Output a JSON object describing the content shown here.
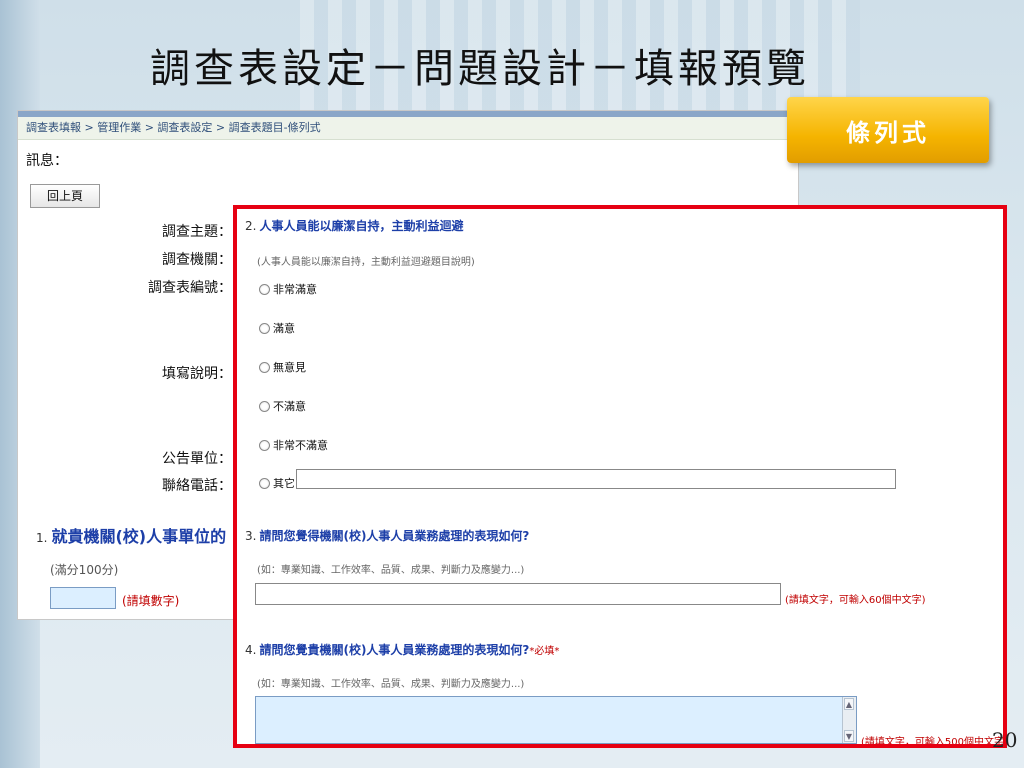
{
  "slide": {
    "title": "調查表設定－問題設計－填報預覽",
    "badge": "條列式",
    "page_number": "20"
  },
  "form": {
    "breadcrumb": "調查表填報 > 管理作業 > 調查表設定 > 調查表題目-條列式",
    "message_label": "訊息：",
    "back_button": "回上頁",
    "fields": [
      "調查主題：",
      "調查機關：",
      "調查表編號：",
      "填寫說明：",
      "公告單位：",
      "聯絡電話："
    ],
    "q1": {
      "number": "1.",
      "title": "就貴機關(校)人事單位的",
      "note": "(滿分100分)",
      "hint": "(請填數字)"
    }
  },
  "panel": {
    "q2": {
      "number": "2.",
      "title": "人事人員能以廉潔自持，主動利益迴避",
      "description": "(人事人員能以廉潔自持，主動利益迴避題目說明)",
      "options": [
        "非常滿意",
        "滿意",
        "無意見",
        "不滿意",
        "非常不滿意",
        "其它"
      ]
    },
    "q3": {
      "number": "3.",
      "title": "請問您覺得機關(校)人事人員業務處理的表現如何?",
      "description": "(如：專業知識、工作效率、品質、成果、判斷力及應變力...)",
      "hint": "(請填文字，可輸入60個中文字)"
    },
    "q4": {
      "number": "4.",
      "title": "請問您覺貴機關(校)人事人員業務處理的表現如何?",
      "required": "*必填*",
      "description": "(如：專業知識、工作效率、品質、成果、判斷力及應變力...)",
      "hint": "(請填文字，可輸入500個中文字)"
    }
  },
  "colors": {
    "panel_border": "#e60012",
    "question_title": "#1d3fa8",
    "hint_red": "#c00000",
    "badge": "#f5b400"
  }
}
